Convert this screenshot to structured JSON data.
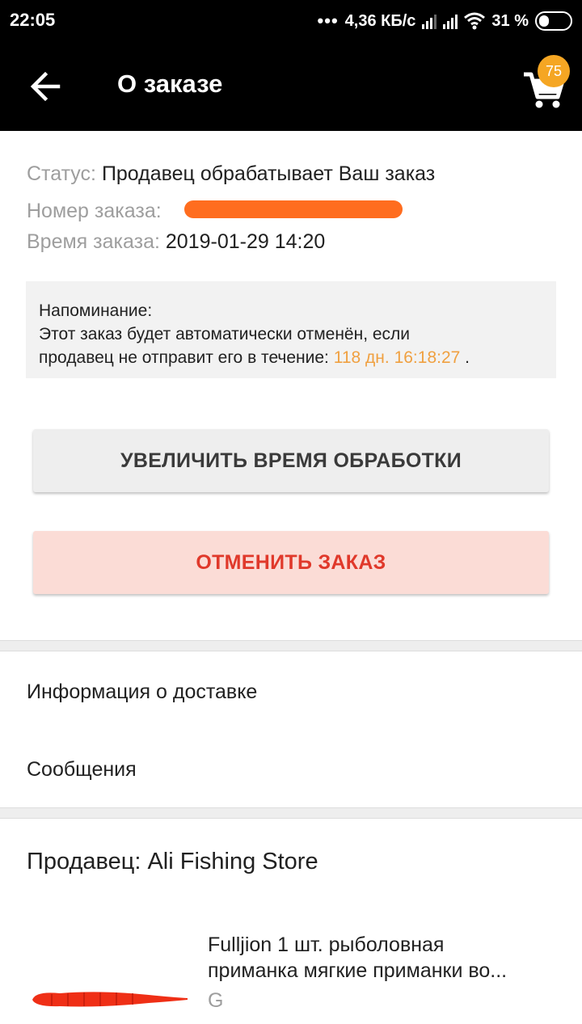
{
  "status_bar": {
    "time": "22:05",
    "dots": "•••",
    "speed": "4,36 КБ/с",
    "battery": "31 %"
  },
  "app_bar": {
    "title": "О заказе",
    "cart_count": "75",
    "back_icon": "arrow-left-icon",
    "cart_icon": "cart-icon"
  },
  "order": {
    "status_label": "Статус:",
    "status_value": "Продавец обрабатывает Ваш заказ",
    "number_label": "Номер заказа:",
    "time_label": "Время заказа:",
    "time_value": "2019-01-29 14:20"
  },
  "reminder": {
    "title": "Напоминание:",
    "line1": "Этот заказ будет автоматически отменён, если",
    "line2": "продавец не отправит его в течение:",
    "countdown": "118 дн. 16:18:27",
    "period": " ."
  },
  "buttons": {
    "extend": "УВЕЛИЧИТЬ ВРЕМЯ ОБРАБОТКИ",
    "cancel": "ОТМЕНИТЬ ЗАКАЗ"
  },
  "menu": {
    "delivery": "Информация о доставке",
    "messages": "Сообщения"
  },
  "seller": {
    "label": "Продавец: Ali Fishing Store"
  },
  "product": {
    "title_line1": "Fulljion 1 шт. рыболовная",
    "title_line2": "приманка мягкие приманки во...",
    "sku": "G"
  },
  "colors": {
    "accent_orange": "#f5a623",
    "countdown": "#f0a040",
    "cancel_text": "#e0392b",
    "cancel_bg": "#fbdcd6"
  }
}
